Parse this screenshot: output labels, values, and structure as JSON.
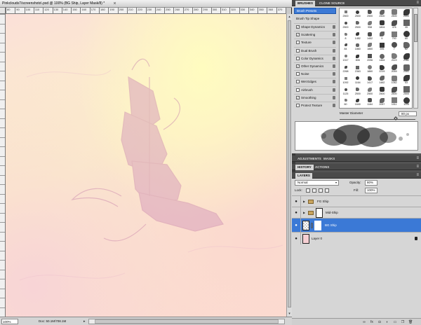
{
  "document": {
    "title": "Pinkclouds7/screenshots\\.psd @ 100% (BG Ship, Layer Mask/8) *",
    "close": "×",
    "ruler_h": [
      "80",
      "90",
      "100",
      "110",
      "120",
      "130",
      "140",
      "150",
      "160",
      "170",
      "180",
      "190",
      "200",
      "210",
      "220",
      "230",
      "240",
      "250",
      "260",
      "270",
      "280",
      "290",
      "300",
      "310",
      "320",
      "330",
      "340",
      "350",
      "360",
      "370",
      "380"
    ],
    "zoom": "100%",
    "doc_info": "Doc: 50.1M/708.1M",
    "status_arrow": "▸",
    "scroll_up": "▴",
    "scroll_down": "▾",
    "canvas_colors": {
      "pink": "#fbe0d8",
      "yellow": "#fcf1c8",
      "ship": "#d9a2bd"
    }
  },
  "brushes_panel": {
    "tabs": [
      "BRUSHES",
      "CLONE SOURCE"
    ],
    "menu": "≡",
    "presets_button": "Brush Presets",
    "tip_shape": "Brush Tip Shape",
    "options": [
      {
        "label": "Shape Dynamics",
        "checked": true
      },
      {
        "label": "Scattering",
        "checked": true
      },
      {
        "label": "Texture",
        "checked": false
      },
      {
        "label": "Dual Brush",
        "checked": false
      },
      {
        "label": "Color Dynamics",
        "checked": false
      },
      {
        "label": "Other Dynamics",
        "checked": true
      },
      {
        "label": "Noise",
        "checked": false
      },
      {
        "label": "Wet Edges",
        "checked": false
      },
      {
        "label": "Airbrush",
        "checked": false
      },
      {
        "label": "Smoothing",
        "checked": true
      },
      {
        "label": "Protect Texture",
        "checked": false
      }
    ],
    "check_mark": "✓",
    "brush_sizes": [
      "2500",
      "2500",
      "2500",
      "2500",
      "2500",
      "2500",
      "2500",
      "2500",
      "958",
      "1804",
      "476",
      "35",
      "8",
      "1452",
      "1452",
      "9",
      "700",
      "60",
      "84",
      "1860",
      "1860",
      "395",
      "7",
      "82",
      "1317",
      "806",
      "2096",
      "1464",
      "2119",
      "2182",
      "2268",
      "2363",
      "1860",
      "2219",
      "2059",
      "2081",
      "1092",
      "1164",
      "1417",
      "1482",
      "1062",
      "53",
      "1125",
      "2500",
      "2500",
      "2500",
      "2500",
      "2500",
      "60",
      "1640",
      "1164",
      "2057",
      "1011",
      "1105"
    ],
    "master_diameter_label": "Master Diameter",
    "master_diameter_value": "80 px",
    "master_diameter_fraction": 0.74
  },
  "adjustments_bar": {
    "tabs": [
      "ADJUSTMENTS",
      "MASKS"
    ]
  },
  "history_bar": {
    "tabs": [
      "HISTORY",
      "ACTIONS"
    ]
  },
  "layers_panel": {
    "tab": "LAYERS",
    "blend_mode": "Normal",
    "dropdown": "▾",
    "opacity_label": "Opacity:",
    "opacity_value": "80%",
    "lock_label": "Lock:",
    "fill_label": "Fill:",
    "fill_value": "100%",
    "eye": "●",
    "expand": "▶",
    "layers": [
      {
        "name": "FG Ship",
        "type": "group"
      },
      {
        "name": "Mid-Ship",
        "type": "group-masked"
      },
      {
        "name": "BG Ship",
        "type": "masked",
        "selected": true
      },
      {
        "name": "Layer 0",
        "type": "locked"
      }
    ],
    "footer_icons": [
      "link-icon",
      "fx-icon",
      "mask-icon",
      "adjustment-icon",
      "group-icon",
      "new-layer-icon",
      "trash-icon"
    ],
    "footer_glyphs": [
      "∞",
      "fx",
      "◘",
      "◐",
      "▭",
      "❐",
      "🗑"
    ]
  }
}
